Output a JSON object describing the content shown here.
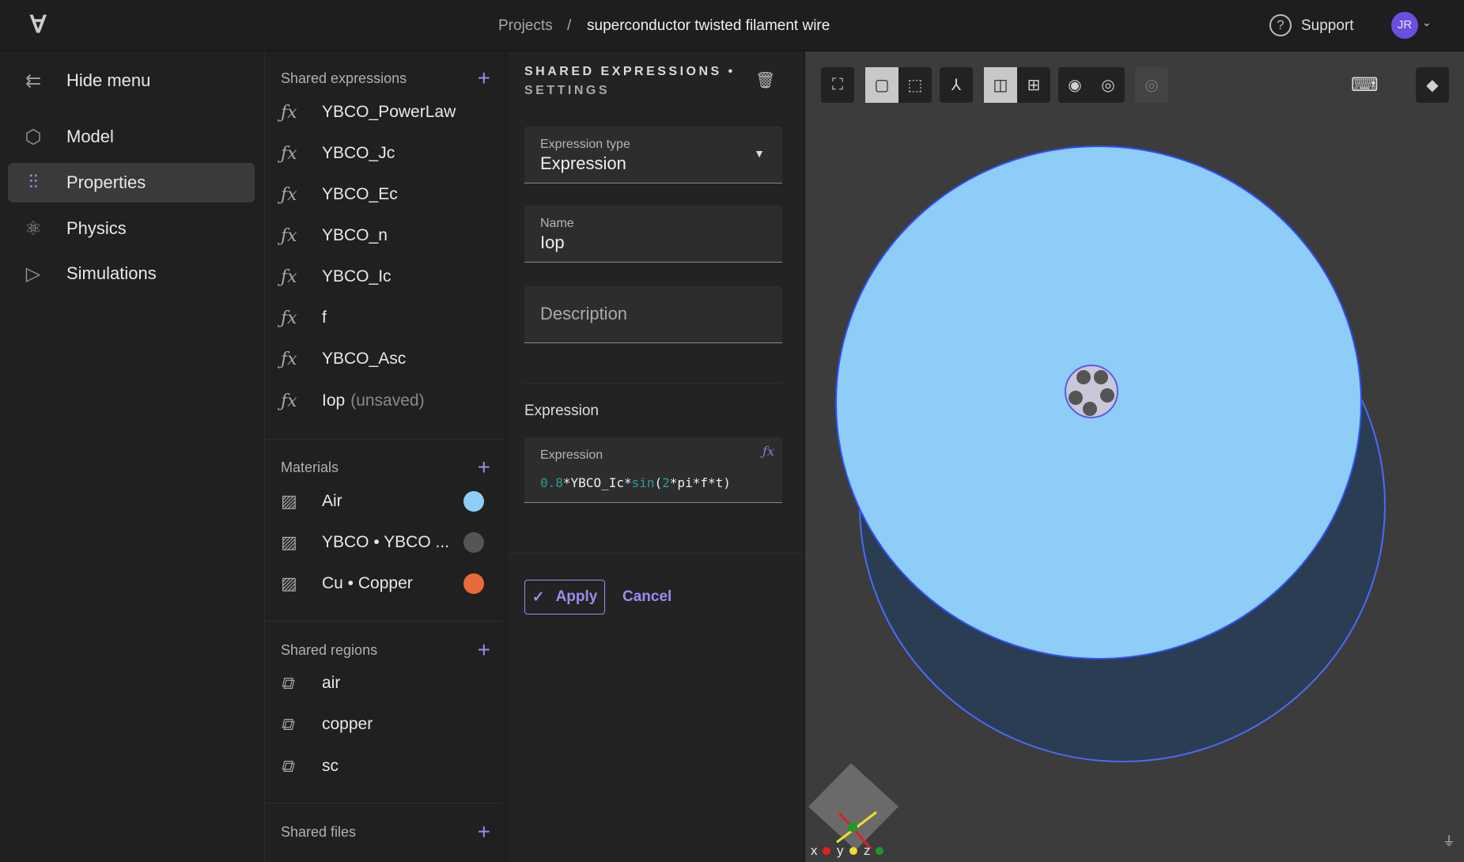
{
  "header": {
    "breadcrumb_root": "Projects",
    "separator": "/",
    "project_name": "superconductor twisted filament wire",
    "support_label": "Support",
    "avatar_initials": "JR"
  },
  "nav": {
    "hide_menu": "Hide menu",
    "items": [
      {
        "label": "Model",
        "icon": "cube-icon"
      },
      {
        "label": "Properties",
        "icon": "sliders-icon",
        "active": true
      },
      {
        "label": "Physics",
        "icon": "atom-icon"
      },
      {
        "label": "Simulations",
        "icon": "play-icon"
      }
    ]
  },
  "shared_expressions": {
    "title": "Shared expressions",
    "items": [
      "YBCO_PowerLaw",
      "YBCO_Jc",
      "YBCO_Ec",
      "YBCO_n",
      "YBCO_Ic",
      "f",
      "YBCO_Asc",
      "Iop"
    ],
    "unsaved_suffix": "(unsaved)"
  },
  "materials": {
    "title": "Materials",
    "items": [
      {
        "label": "Air",
        "color": "#8ecdf8"
      },
      {
        "label": "YBCO • YBCO ...",
        "color": "#555555"
      },
      {
        "label": "Cu • Copper",
        "color": "#e8693a"
      }
    ]
  },
  "shared_regions": {
    "title": "Shared regions",
    "items": [
      "air",
      "copper",
      "sc"
    ]
  },
  "shared_files": {
    "title": "Shared files"
  },
  "panel": {
    "title_line1": "SHARED EXPRESSIONS •",
    "title_line2": "SETTINGS",
    "expression_type_label": "Expression type",
    "expression_type_value": "Expression",
    "name_label": "Name",
    "name_value": "Iop",
    "description_placeholder": "Description",
    "expression_section": "Expression",
    "expression_label": "Expression",
    "expr": {
      "n1": "0.8",
      "p1": "*YBCO_Ic*",
      "fn": "sin",
      "p2": "(",
      "n2": "2",
      "p3": "*pi*f*t)"
    },
    "apply": "Apply",
    "cancel": "Cancel"
  },
  "viewport": {
    "axes": {
      "x": "x",
      "y": "y",
      "z": "z"
    },
    "colors": {
      "x": "#e02020",
      "y": "#e8e030",
      "z": "#1a9a2a",
      "disk": "#8ecdf8"
    }
  },
  "accent": "#9b8cf0"
}
